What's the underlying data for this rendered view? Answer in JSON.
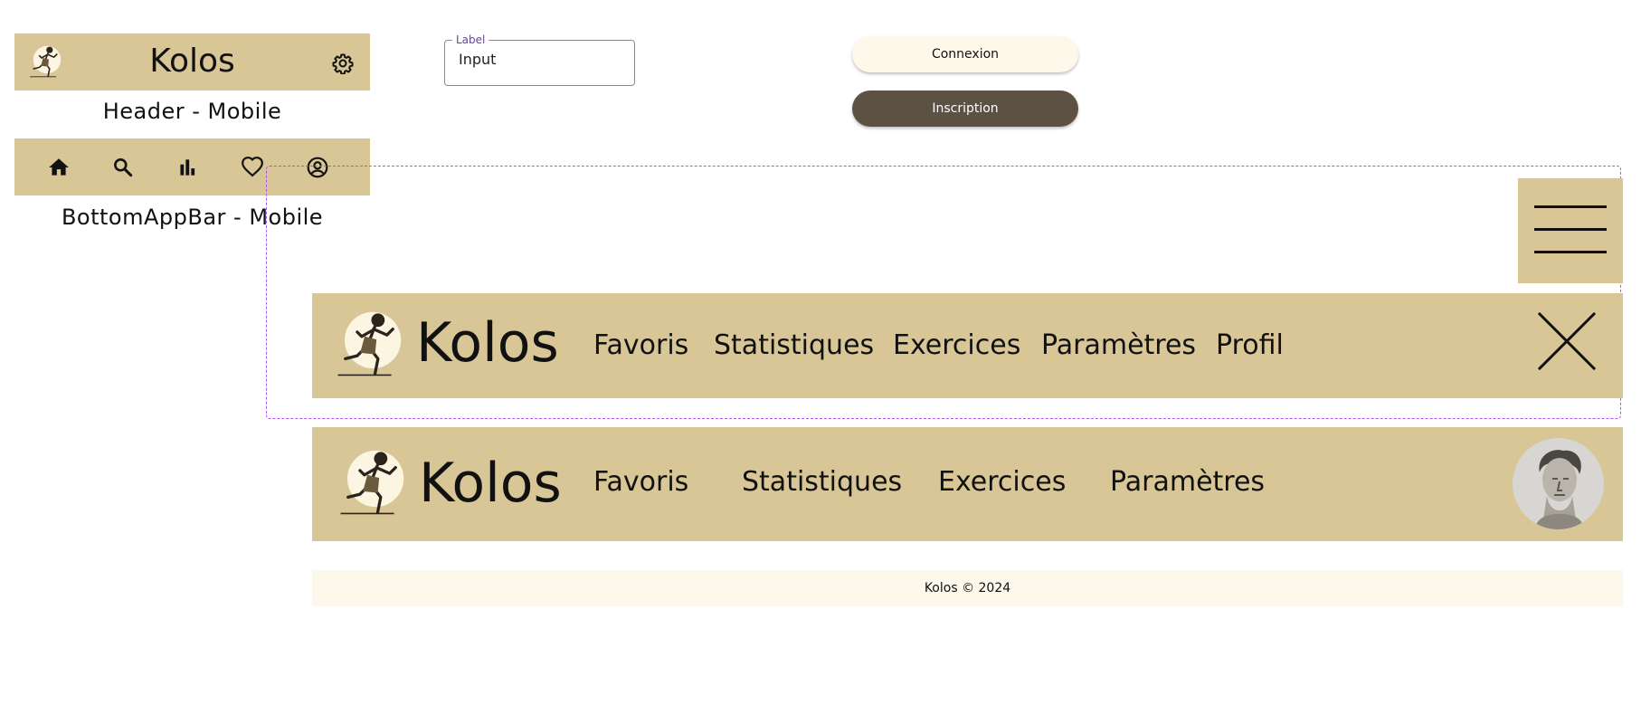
{
  "mobile_header": {
    "brand": "Kolos",
    "caption": "Header - Mobile"
  },
  "bottom_bar": {
    "items": [
      {
        "icon": "home-icon"
      },
      {
        "icon": "search-icon"
      },
      {
        "icon": "bar-chart-icon"
      },
      {
        "icon": "heart-icon"
      },
      {
        "icon": "account-circle-icon"
      }
    ],
    "caption": "BottomAppBar - Mobile"
  },
  "input": {
    "label": "Label",
    "value": "Input"
  },
  "buttons": {
    "login": "Connexion",
    "signup": "Inscription"
  },
  "menu_open_header": {
    "brand": "Kolos",
    "nav": [
      "Favoris",
      "Statistiques",
      "Exercices",
      "Paramètres",
      "Profil"
    ]
  },
  "desktop_header": {
    "brand": "Kolos",
    "nav": [
      "Favoris",
      "Statistiques",
      "Exercices",
      "Paramètres"
    ]
  },
  "footer": {
    "text": "Kolos © 2024"
  },
  "colors": {
    "header_bg": "#d9c697",
    "cream": "#fdf8ea",
    "dark_button": "#5c5143",
    "selection": "#a855f7"
  }
}
